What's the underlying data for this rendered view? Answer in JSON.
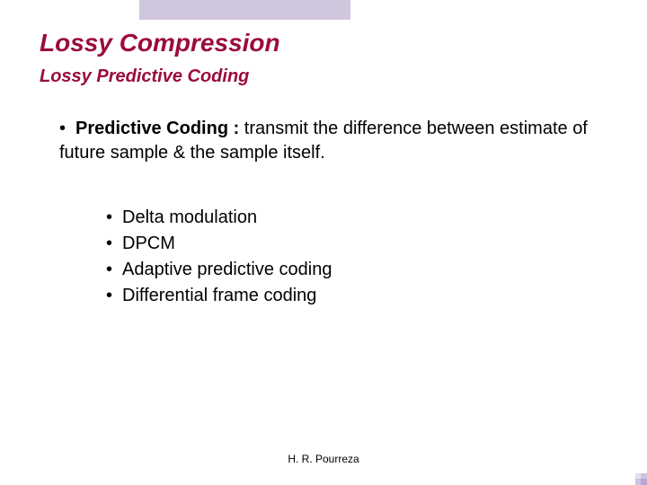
{
  "title": "Lossy Compression",
  "subtitle": "Lossy Predictive Coding",
  "main": {
    "bullet": "•",
    "lead": "Predictive  Coding :",
    "rest": "    transmit the difference between estimate of future sample &  the sample itself."
  },
  "sublist": {
    "bullet": "•",
    "items": [
      "Delta modulation",
      "DPCM",
      "Adaptive predictive coding",
      "Differential frame coding"
    ]
  },
  "footer": "H. R. Pourreza"
}
